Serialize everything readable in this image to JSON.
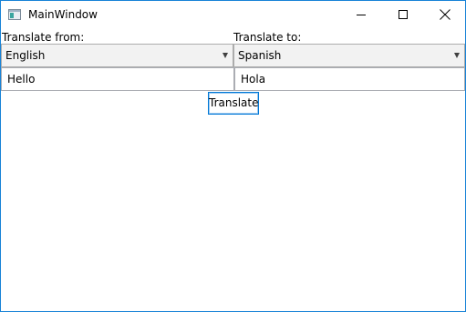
{
  "window": {
    "title": "MainWindow"
  },
  "source": {
    "label": "Translate from:",
    "language": "English",
    "text": "Hello"
  },
  "target": {
    "label": "Translate to:",
    "language": "Spanish",
    "text": "Hola"
  },
  "actions": {
    "translate_label": "Translate"
  },
  "icons": {
    "app": "app-window-icon",
    "minimize": "minimize-icon",
    "maximize": "maximize-icon",
    "close": "close-icon",
    "dropdown": "chevron-down-icon"
  },
  "colors": {
    "window_border": "#1883d7",
    "button_focus_border": "#0078d7",
    "combo_background": "#f2f2f2"
  }
}
